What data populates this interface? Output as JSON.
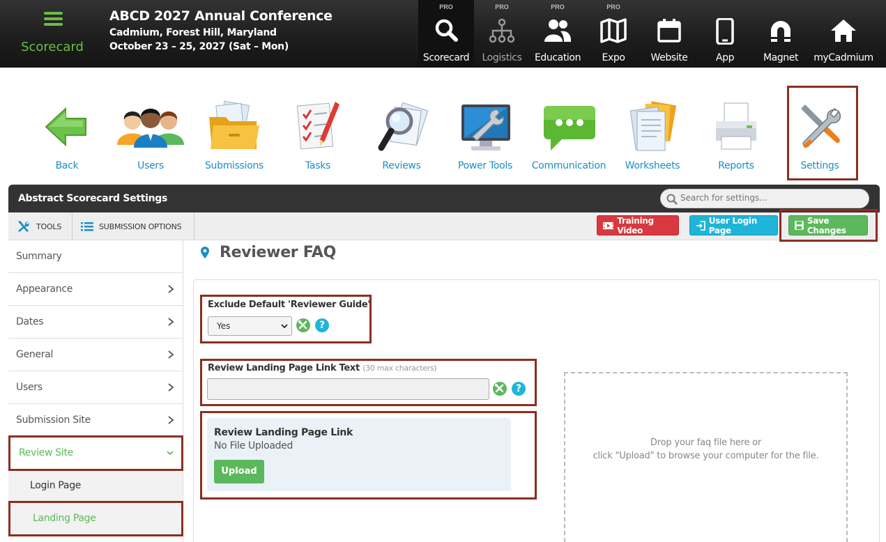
{
  "brand": {
    "name": "Scorecard"
  },
  "event": {
    "title": "ABCD 2027 Annual Conference",
    "location": "Cadmium, Forest Hill, Maryland",
    "dates": "October 23 – 25, 2027 (Sat – Mon)"
  },
  "topnav": [
    {
      "label": "Scorecard",
      "badge": "PRO",
      "icon": "search-icon"
    },
    {
      "label": "Logistics",
      "badge": "PRO",
      "icon": "org-chart-icon"
    },
    {
      "label": "Education",
      "badge": "PRO",
      "icon": "people-icon"
    },
    {
      "label": "Expo",
      "badge": "PRO",
      "icon": "map-icon"
    },
    {
      "label": "Website",
      "badge": "",
      "icon": "calendar-icon"
    },
    {
      "label": "App",
      "badge": "",
      "icon": "phone-icon"
    },
    {
      "label": "Magnet",
      "badge": "",
      "icon": "magnet-icon"
    },
    {
      "label": "myCadmium",
      "badge": "",
      "icon": "home-icon"
    }
  ],
  "apps": [
    {
      "label": "Back",
      "icon": "back-arrow-icon"
    },
    {
      "label": "Users",
      "icon": "users-icon"
    },
    {
      "label": "Submissions",
      "icon": "folder-icon"
    },
    {
      "label": "Tasks",
      "icon": "checklist-icon"
    },
    {
      "label": "Reviews",
      "icon": "magnifier-icon"
    },
    {
      "label": "Power Tools",
      "icon": "monitor-wrench-icon"
    },
    {
      "label": "Communication",
      "icon": "chat-bubble-icon"
    },
    {
      "label": "Worksheets",
      "icon": "documents-icon"
    },
    {
      "label": "Reports",
      "icon": "printer-icon"
    },
    {
      "label": "Settings",
      "icon": "tools-icon"
    }
  ],
  "panel": {
    "title": "Abstract Scorecard Settings",
    "search_placeholder": "Search for settings..."
  },
  "toolbar": {
    "tools": "TOOLS",
    "submission_options": "SUBMISSION OPTIONS",
    "training_video": "Training Video",
    "user_login_page": "User Login Page",
    "save_changes": "Save Changes"
  },
  "sidebar": [
    {
      "label": "Summary",
      "chevron": ""
    },
    {
      "label": "Appearance",
      "chevron": "right"
    },
    {
      "label": "Dates",
      "chevron": "right"
    },
    {
      "label": "General",
      "chevron": "right"
    },
    {
      "label": "Users",
      "chevron": "right"
    },
    {
      "label": "Submission Site",
      "chevron": "right"
    },
    {
      "label": "Review Site",
      "chevron": "down"
    },
    {
      "label": "Login Page",
      "chevron": ""
    },
    {
      "label": "Landing Page",
      "chevron": ""
    }
  ],
  "main": {
    "title": "Reviewer FAQ",
    "exclude_label": "Exclude Default 'Reviewer Guide'",
    "exclude_value": "Yes",
    "link_text_label": "Review Landing Page Link Text",
    "link_text_hint": "(30 max characters)",
    "link_text_value": "",
    "help_glyph": "?",
    "upload_title": "Review Landing Page Link",
    "upload_status": "No File Uploaded",
    "upload_button": "Upload",
    "drop_line1": "Drop your faq file here or",
    "drop_line2": "click \"Upload\" to browse your computer for the file."
  },
  "colors": {
    "accent_green": "#5cb85c",
    "link_blue": "#1a8fc4",
    "highlight": "#8b2e23",
    "danger": "#d9383f",
    "info": "#1fb5d8"
  }
}
